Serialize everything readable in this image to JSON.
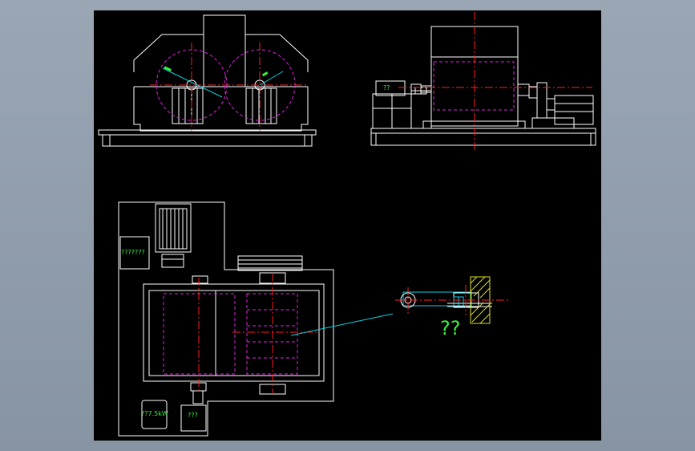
{
  "drawing": {
    "colors": {
      "background": "#000000",
      "outline": "#ffffff",
      "centerline": "#ff2020",
      "hidden_line": "#e020e0",
      "leader": "#10d0e0",
      "text": "#3cf03c",
      "hatch": "#e0e020"
    },
    "labels": {
      "side_panel_label": "??",
      "top_box_label": "???????",
      "motor_box_label": "??7.5kW",
      "bottom_box_label": "???",
      "detail_callout": "??"
    }
  }
}
